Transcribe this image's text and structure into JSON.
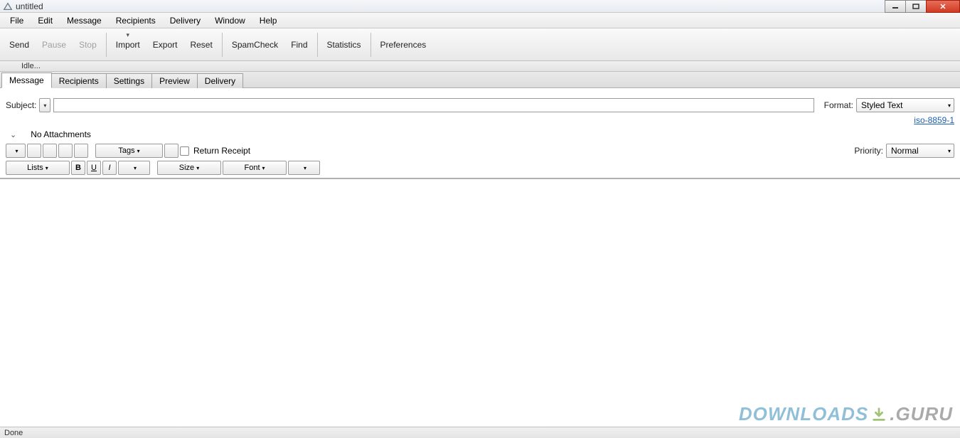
{
  "window": {
    "title": "untitled"
  },
  "win_controls": {
    "minimize": "minimize",
    "maximize": "maximize",
    "close": "close"
  },
  "menu": {
    "items": [
      "File",
      "Edit",
      "Message",
      "Recipients",
      "Delivery",
      "Window",
      "Help"
    ]
  },
  "toolbar": {
    "send": "Send",
    "pause": "Pause",
    "stop": "Stop",
    "import": "Import",
    "export": "Export",
    "reset": "Reset",
    "spamcheck": "SpamCheck",
    "find": "Find",
    "statistics": "Statistics",
    "preferences": "Preferences"
  },
  "status_top": "Idle...",
  "tabs": {
    "items": [
      "Message",
      "Recipients",
      "Settings",
      "Preview",
      "Delivery"
    ],
    "active": 0
  },
  "subject": {
    "label": "Subject:",
    "value": ""
  },
  "format": {
    "label": "Format:",
    "value": "Styled Text"
  },
  "encoding_link": "iso-8859-1",
  "attachments": {
    "label": "No Attachments"
  },
  "tags_btn": "Tags",
  "return_receipt": "Return Receipt",
  "priority": {
    "label": "Priority:",
    "value": "Normal"
  },
  "format_toolbar": {
    "lists": "Lists",
    "bold": "B",
    "underline": "U",
    "italic": "I",
    "size": "Size",
    "font": "Font"
  },
  "status_bottom": "Done",
  "watermark": {
    "left": "DOWNLOADS",
    "right": ".GURU"
  }
}
